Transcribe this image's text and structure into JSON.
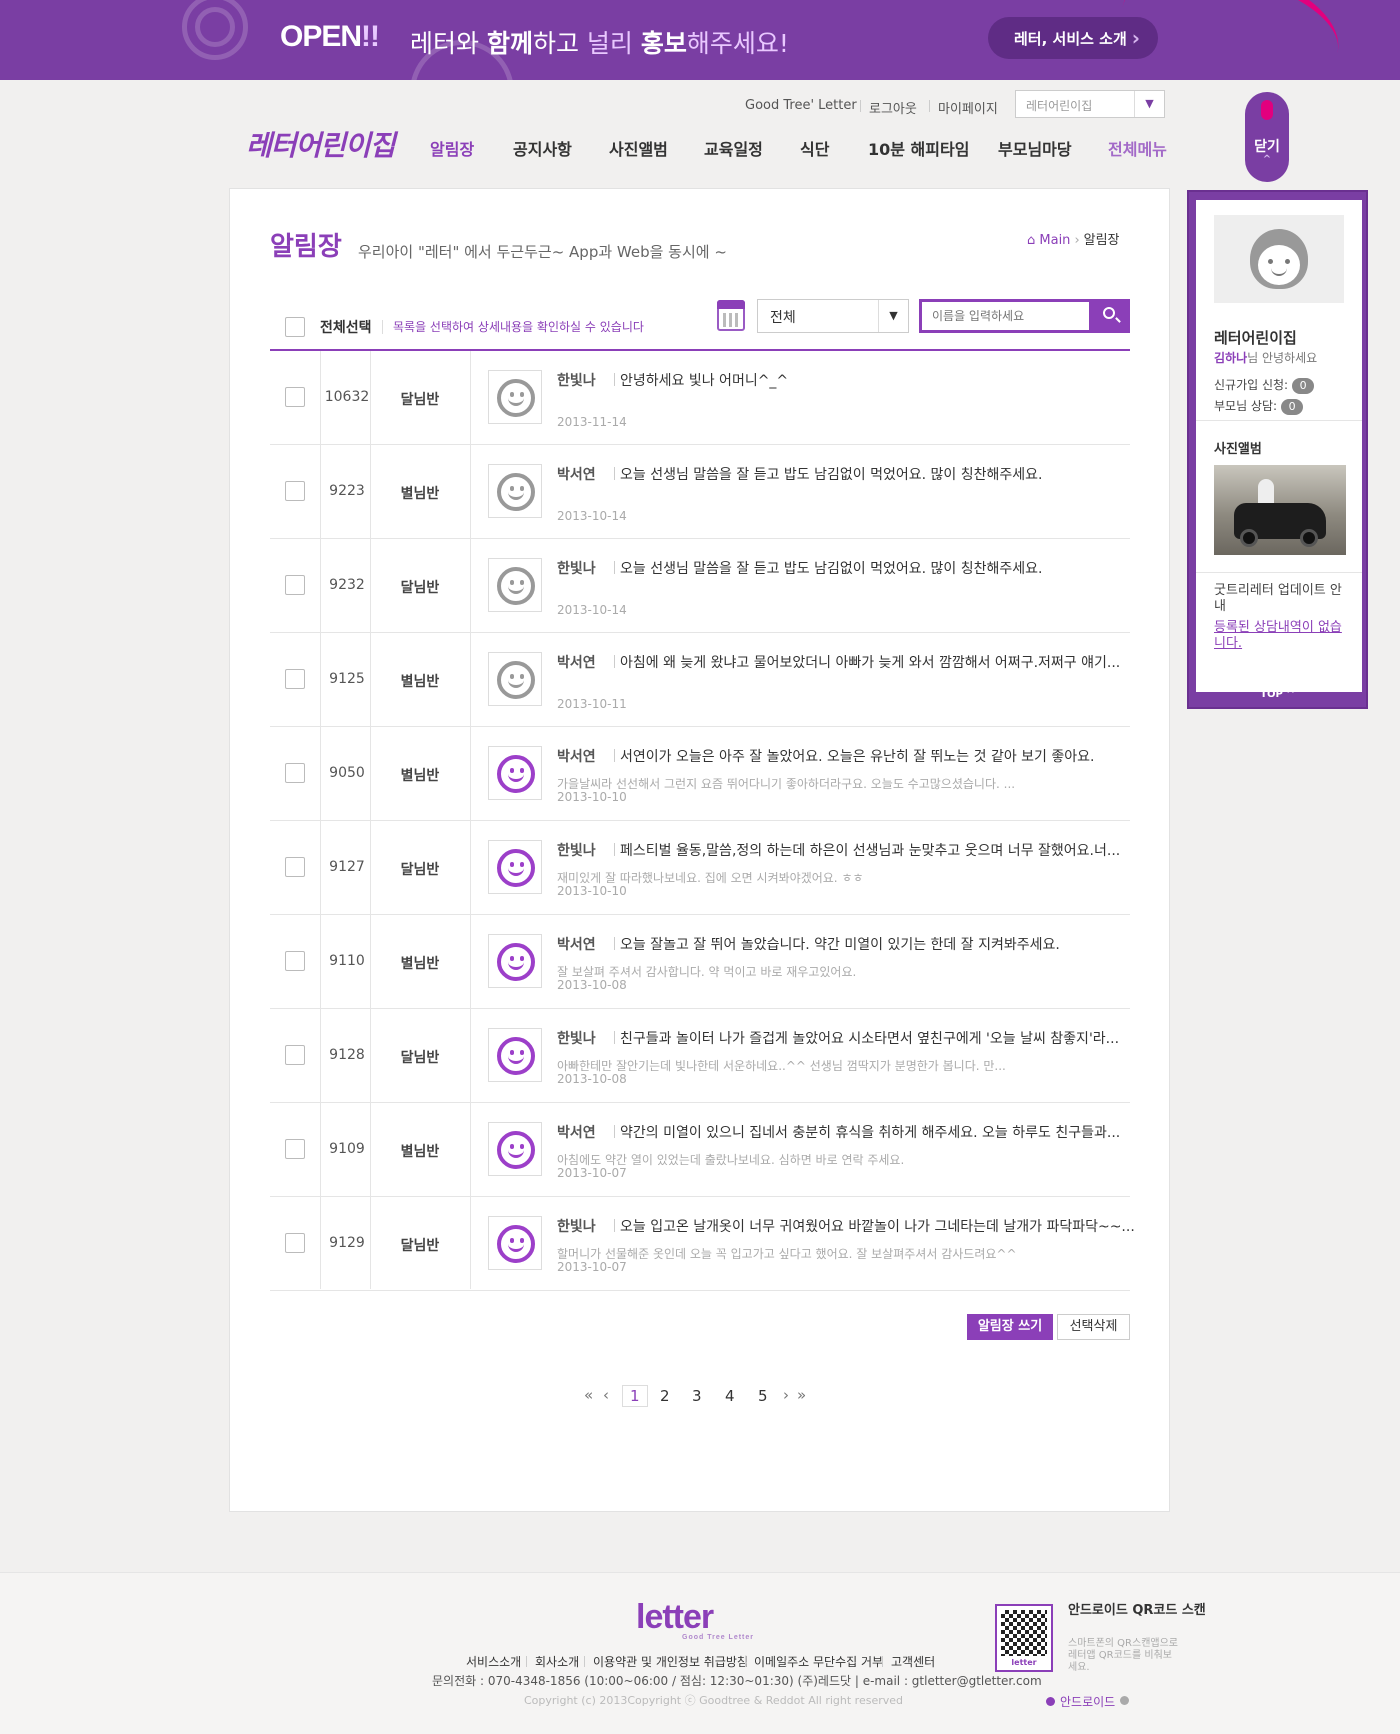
{
  "banner": {
    "open": "OPEN",
    "open_bang": "!!",
    "slogan_a": "레터와 ",
    "slogan_b": "함께",
    "slogan_c": "하고 ",
    "slogan_d": "널리 ",
    "slogan_e": "홍보",
    "slogan_f": "해주세요!",
    "button": "레터, 서비스 소개"
  },
  "header": {
    "logo": "레터어린이집",
    "util": [
      "Good Tree' Letter",
      "로그아웃",
      "마이페이지"
    ],
    "site_select": "레터어린이집",
    "nav": [
      "알림장",
      "공지사항",
      "사진앨범",
      "교육일정",
      "식단",
      "10분 해피타임",
      "부모님마당",
      "전체메뉴"
    ],
    "close_tab": "닫기"
  },
  "page": {
    "title": "알림장",
    "desc": "우리아이 \"레터\" 에서 두근두근~ App과 Web을 동시에 ~",
    "crumb_home": "Main",
    "crumb_current": "알림장"
  },
  "toolbar": {
    "select_all": "전체선택",
    "hint": "목록을 선택하여 상세내용을 확인하실 수 있습니다",
    "filter": "전체",
    "search_placeholder": "이름을 입력하세요"
  },
  "rows": [
    {
      "num": "10632",
      "cls": "달님반",
      "writer": "한빛나",
      "title": "안녕하세요 빛나 어머니^_^",
      "excerpt": "",
      "date": "2013-11-14"
    },
    {
      "num": "9223",
      "cls": "별님반",
      "writer": "박서연",
      "title": "오늘 선생님 말씀을 잘 듣고 밥도 남김없이 먹었어요. 많이 칭찬해주세요.",
      "excerpt": "",
      "date": "2013-10-14"
    },
    {
      "num": "9232",
      "cls": "달님반",
      "writer": "한빛나",
      "title": "오늘 선생님 말씀을 잘 듣고 밥도 남김없이 먹었어요. 많이 칭찬해주세요.",
      "excerpt": "",
      "date": "2013-10-14"
    },
    {
      "num": "9125",
      "cls": "별님반",
      "writer": "박서연",
      "title": "아침에 왜 늦게 왔냐고 물어보았더니 아빠가 늦게 와서 깜깜해서 어쩌구.저쩌구 얘기...",
      "excerpt": "",
      "date": "2013-10-11"
    },
    {
      "num": "9050",
      "cls": "별님반",
      "writer": "박서연",
      "title": "서연이가 오늘은 아주 잘 놀았어요. 오늘은 유난히 잘 뛰노는 것 같아 보기 좋아요.",
      "excerpt": "가을날씨라 선선해서 그런지 요즘 뛰어다니기 좋아하더라구요. 오늘도 수고많으셨습니다. ...",
      "date": "2013-10-10"
    },
    {
      "num": "9127",
      "cls": "달님반",
      "writer": "한빛나",
      "title": "페스티벌 율동,말씀,정의 하는데 하은이 선생님과 눈맞추고 웃으며 너무 잘했어요.너...",
      "excerpt": "재미있게 잘 따라했나보네요. 집에 오면 시켜봐야겠어요. ㅎㅎ",
      "date": "2013-10-10"
    },
    {
      "num": "9110",
      "cls": "별님반",
      "writer": "박서연",
      "title": "오늘 잘놀고 잘 뛰어 놀았습니다. 약간 미열이 있기는 한데 잘 지켜봐주세요.",
      "excerpt": "잘 보살펴 주셔서 감사합니다. 약 먹이고 바로 재우고있어요.",
      "date": "2013-10-08"
    },
    {
      "num": "9128",
      "cls": "달님반",
      "writer": "한빛나",
      "title": "친구들과 놀이터 나가 즐겁게 놀았어요 시소타면서 옆친구에게 '오늘 날씨 참좋지'라...",
      "excerpt": "아빠한테만 잘안기는데 빛나한테 서운하네요..^^ 선생님 껌딱지가 분명한가 봅니다. 만...",
      "date": "2013-10-08"
    },
    {
      "num": "9109",
      "cls": "별님반",
      "writer": "박서연",
      "title": "약간의 미열이 있으니 집네서 충분히 휴식을 취하게 해주세요. 오늘 하루도 친구들과...",
      "excerpt": "아침에도 약간 열이 있었는데 출랐나보네요. 심하면 바로 연락 주세요.",
      "date": "2013-10-07"
    },
    {
      "num": "9129",
      "cls": "달님반",
      "writer": "한빛나",
      "title": "오늘 입고온 날개옷이 너무 귀여웠어요 바깥놀이 나가 그네타는데 날개가 파닥파닥~~...",
      "excerpt": "할머니가 선물해준 옷인데 오늘 꼭 입고가고 싶다고 했어요. 잘 보살펴주셔서 감사드려요^^",
      "date": "2013-10-07"
    }
  ],
  "actions": {
    "write": "알림장 쓰기",
    "delete": "선택삭제"
  },
  "pager": {
    "first": "«",
    "prev": "‹",
    "pages": [
      "1",
      "2",
      "3",
      "4",
      "5"
    ],
    "next": "›",
    "last": "»"
  },
  "side": {
    "name": "레터어린이집",
    "user": "김하나",
    "hello": "님 안녕하세요",
    "signup_label": "신규가입 신청:",
    "signup_count": "0",
    "consult_label": "부모님 상담:",
    "consult_count": "0",
    "photo_title": "사진앨범",
    "update": "굿트리레터 업데이트 안내",
    "link": "등록된 상담내역이 없습니다.",
    "top": "TOP ^"
  },
  "footer": {
    "logo": "letter",
    "logo_sub": "Good Tree Letter",
    "links": [
      "서비스소개",
      "회사소개",
      "이용약관 및 개인정보 취급방침",
      "이메일주소 무단수집 거부",
      "고객센터"
    ],
    "contact": "문의전화 : 070-4348-1856 (10:00~06:00 / 점심: 12:30~01:30) (주)레드닷  |  e-mail : gtletter@gtletter.com",
    "copyright": "Copyright (c) 2013Copyright ⓒ Goodtree & Reddot All right reserved",
    "qr_tag": "letter",
    "qr_title": "안드로이드 QR코드 스캔",
    "qr_desc": "스마트폰의 QR스캔앱으로 레터앱 QR코드를 비춰보세요.",
    "android": "안드로이드"
  },
  "colors": {
    "brand": "#8b3fb8",
    "banner": "#7a3ea3",
    "accent_ribbon": "#e2007e"
  }
}
